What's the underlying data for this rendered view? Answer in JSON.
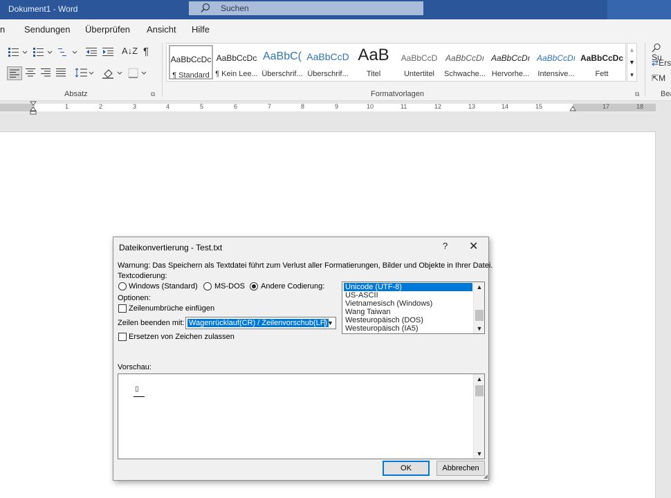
{
  "titlebar": {
    "doc_title": "Dokument1 - Word",
    "search_placeholder": "Suchen"
  },
  "tabs": [
    "n",
    "Sendungen",
    "Überprüfen",
    "Ansicht",
    "Hilfe"
  ],
  "ribbon": {
    "group_absatz": "Absatz",
    "group_formatvorlagen": "Formatvorlagen",
    "group_bearbeiten_partial": "Bea",
    "styles": [
      {
        "preview": "AaBbCcDc",
        "name": "¶ Standard"
      },
      {
        "preview": "AaBbCcDc",
        "name": "¶ Kein Lee..."
      },
      {
        "preview": "AaBbC(",
        "name": "Überschrif..."
      },
      {
        "preview": "AaBbCcD",
        "name": "Überschrif..."
      },
      {
        "preview": "AaB",
        "name": "Titel"
      },
      {
        "preview": "AaBbCcD",
        "name": "Untertitel"
      },
      {
        "preview": "AaBbCcDı",
        "name": "Schwache..."
      },
      {
        "preview": "AaBbCcDı",
        "name": "Hervorhe..."
      },
      {
        "preview": "AaBbCcDı",
        "name": "Intensive..."
      },
      {
        "preview": "AaBbCcDc",
        "name": "Fett"
      }
    ],
    "right_items": [
      "Su",
      "Ers",
      "M"
    ]
  },
  "ruler": {
    "numbers": [
      "1",
      "2",
      "3",
      "4",
      "5",
      "6",
      "7",
      "8",
      "9",
      "10",
      "11",
      "12",
      "13",
      "14",
      "15",
      "17",
      "18"
    ]
  },
  "dialog": {
    "title": "Dateikonvertierung - Test.txt",
    "help": "?",
    "close": "✕",
    "warning": "Warnung: Das Speichern als Textdatei führt zum Verlust aller Formatierungen, Bilder und Objekte in Ihrer Datei.",
    "encoding_label": "Textcodierung:",
    "radio_windows": "Windows (Standard)",
    "radio_msdos": "MS-DOS",
    "radio_other": "Andere Codierung:",
    "options_label": "Optionen:",
    "check_linebreaks": "Zeilenumbrüche einfügen",
    "line_end_label": "Zeilen beenden mit:",
    "line_end_value": "Wagenrücklauf(CR) / Zeilenvorschub(LF)",
    "check_replace": "Ersetzen von Zeichen zulassen",
    "encodings": [
      "Unicode (UTF-8)",
      "US-ASCII",
      "Vietnamesisch (Windows)",
      "Wang Taiwan",
      "Westeuropäisch (DOS)",
      "Westeuropäisch (IA5)"
    ],
    "selected_encoding": "Unicode (UTF-8)",
    "preview_label": "Vorschau:",
    "preview_glyph": "▯",
    "ok": "OK",
    "cancel": "Abbrechen"
  },
  "colors": {
    "title_bar": "#2b579a",
    "selection": "#0078d7"
  }
}
